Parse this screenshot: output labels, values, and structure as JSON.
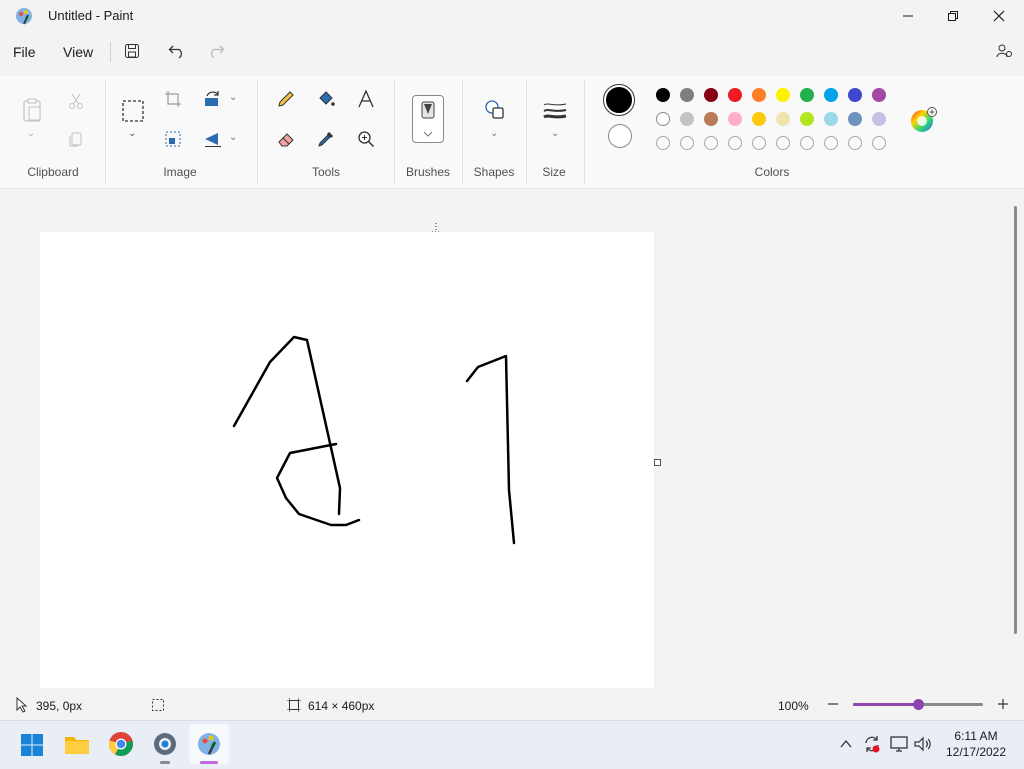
{
  "window": {
    "title": "Untitled - Paint"
  },
  "menu": {
    "file": "File",
    "view": "View"
  },
  "ribbon": {
    "groups": {
      "clipboard": "Clipboard",
      "image": "Image",
      "tools": "Tools",
      "brushes": "Brushes",
      "shapes": "Shapes",
      "size": "Size",
      "colors": "Colors"
    },
    "primary_color": "#000000",
    "secondary_color": "#ffffff",
    "palette_row1": [
      "#000000",
      "#7f7f7f",
      "#880015",
      "#ed1c24",
      "#ff7f27",
      "#fff200",
      "#22b14c",
      "#00a2e8",
      "#3f48cc",
      "#a349a4"
    ],
    "palette_row2": [
      "#ffffff",
      "#c3c3c3",
      "#b97a57",
      "#ffaec9",
      "#ffc90e",
      "#efe4b0",
      "#b5e61d",
      "#99d9ea",
      "#7092be",
      "#c8bfe7"
    ]
  },
  "status": {
    "cursor_pos": "395, 0px",
    "canvas_size": "614 × 460px",
    "zoom": "100%",
    "zoom_level": 0.5
  },
  "taskbar": {
    "time": "6:11 AM",
    "date": "12/17/2022"
  }
}
